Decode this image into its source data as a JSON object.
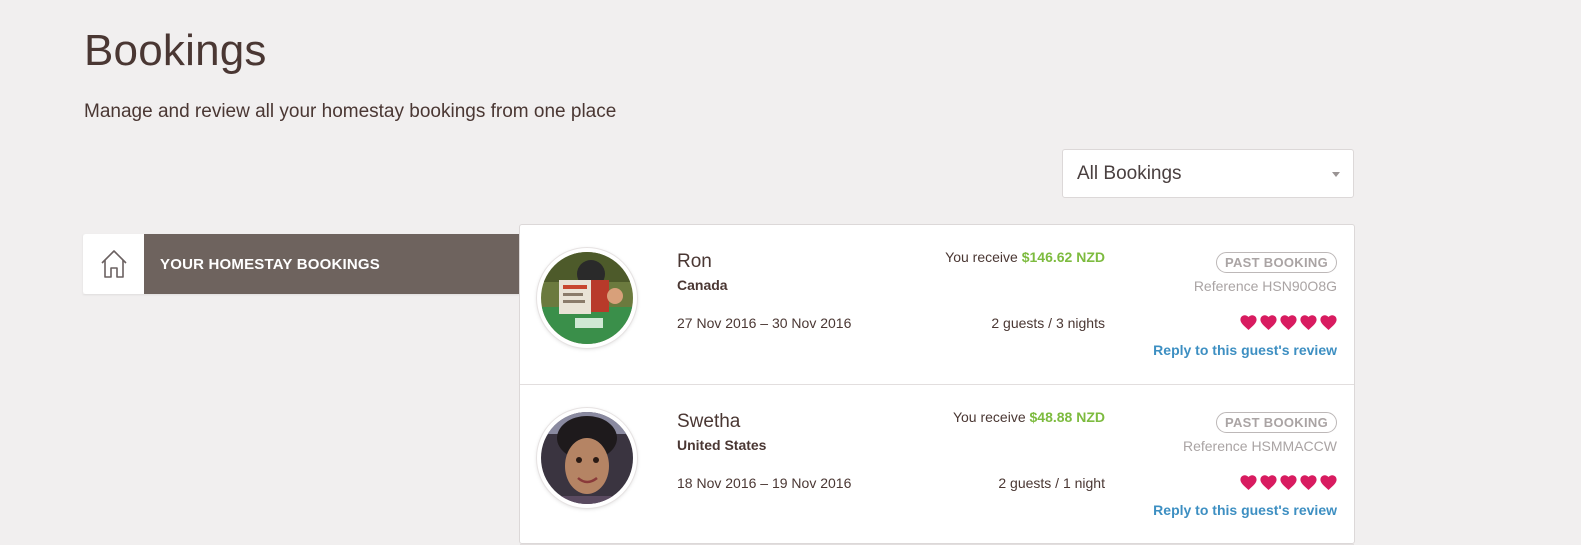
{
  "header": {
    "title": "Bookings",
    "subtitle": "Manage and review all your homestay bookings from one place"
  },
  "filter": {
    "selected": "All Bookings",
    "caret_icon": "caret-down-icon"
  },
  "sidebar": {
    "tab_label": "YOUR HOMESTAY BOOKINGS",
    "tab_icon": "house-icon"
  },
  "colors": {
    "amount": "#7dbb3f",
    "link": "#3d8fc2",
    "heart": "#d81b60",
    "sidebar_active": "#6e635e"
  },
  "bookings": [
    {
      "name": "Ron",
      "country": "Canada",
      "dates": "27 Nov 2016 – 30 Nov 2016",
      "receive_label": "You receive",
      "amount": "$146.62 NZD",
      "guests": "2 guests / 3 nights",
      "status": "PAST BOOKING",
      "reference": "Reference HSN90O8G",
      "rating": 5,
      "reply_label": "Reply to this guest's review"
    },
    {
      "name": "Swetha",
      "country": "United States",
      "dates": "18 Nov 2016 – 19 Nov 2016",
      "receive_label": "You receive",
      "amount": "$48.88 NZD",
      "guests": "2 guests / 1 night",
      "status": "PAST BOOKING",
      "reference": "Reference HSMMACCW",
      "rating": 5,
      "reply_label": "Reply to this guest's review"
    }
  ]
}
